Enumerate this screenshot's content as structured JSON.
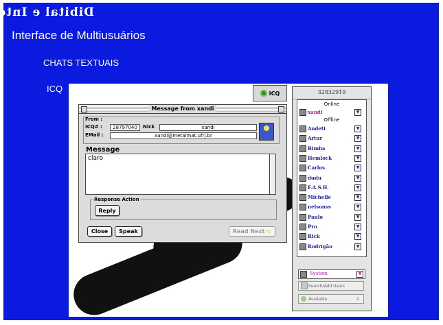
{
  "slide": {
    "title": "Interface de Multiusuários",
    "section": "CHATS TEXTUAIS",
    "app_label": "ICQ",
    "mirrored_heading": "Dibital e Interfaces"
  },
  "icq_button": {
    "label": "ICQ"
  },
  "message_window": {
    "title": "Message from xandi",
    "from_label": "From :",
    "icq_label": "ICQ# :",
    "icq_value": "28797040",
    "nick_label": "Nick",
    "nick_value": "xandi",
    "email_label": "EMail :",
    "email_value": "xandi@metalmat.ufrj.br",
    "message_label": "Message",
    "message_text": "claro",
    "response_label": "Response Action",
    "reply_label": "Reply",
    "close_label": "Close",
    "speak_label": "Speak",
    "read_next_label": "Read Next"
  },
  "contact_list": {
    "uin": "32832919",
    "online_header": "Online",
    "online_users": [
      "xandi"
    ],
    "offline_header": "Offline",
    "offline_users": [
      "Andeti",
      "Artur",
      "Bimba",
      "Hemlock",
      "Carlos",
      "dudu",
      "F.A.S.H.",
      "Michelle",
      "nelsonss",
      "Paulo",
      "Pro",
      "Rick",
      "Rodrigão"
    ],
    "system_label": "System",
    "search_label": "Search/Add Users",
    "status_label": "Available"
  }
}
